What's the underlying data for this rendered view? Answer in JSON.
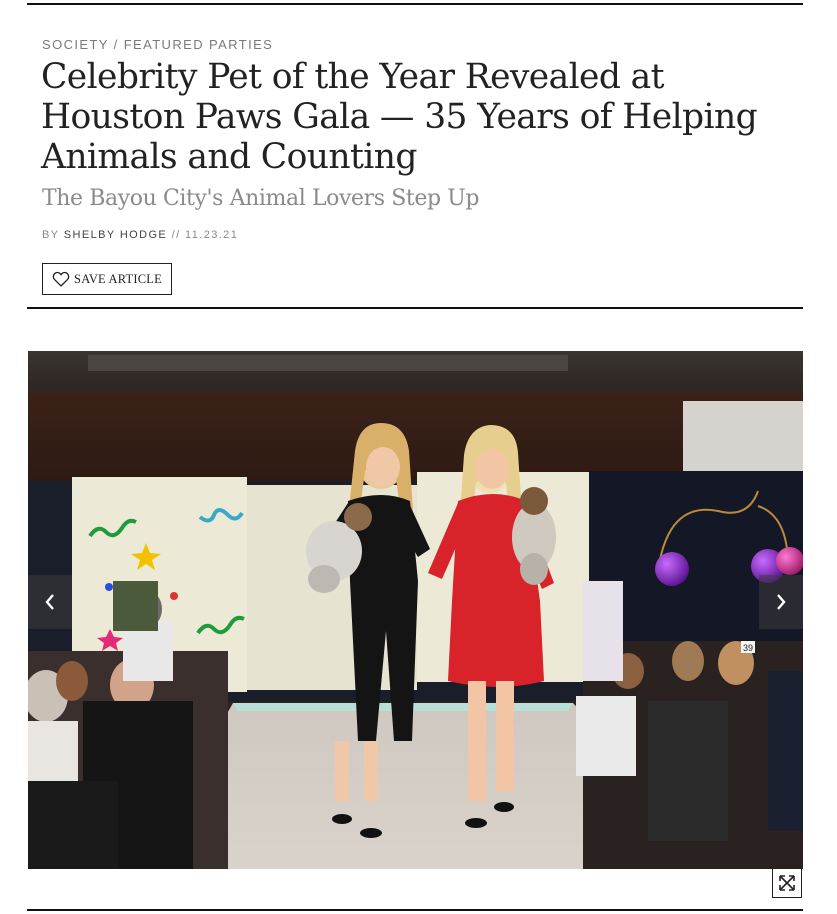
{
  "breadcrumb": {
    "section": "SOCIETY",
    "separator": "/",
    "subsection": "FEATURED PARTIES"
  },
  "article": {
    "title": "Celebrity Pet of the Year Revealed at Houston Paws Gala — 35 Years of Helping Animals and Counting",
    "subtitle": "The Bayou City's Animal Lovers Step Up",
    "byline_prefix": "BY",
    "author": "SHELBY HODGE",
    "date_separator": "//",
    "date": "11.23.21"
  },
  "actions": {
    "save_label": "SAVE ARTICLE",
    "save_icon": "heart-outline-icon"
  },
  "gallery": {
    "prev_icon": "chevron-left-icon",
    "next_icon": "chevron-right-icon",
    "expand_icon": "expand-arrows-icon",
    "runway_number_sign": "39"
  },
  "colors": {
    "text_primary": "#222222",
    "text_muted": "#8a8a8a",
    "rule": "#111111",
    "dress_red": "#d8232a",
    "balloon_purple": "#7a1fb0"
  }
}
